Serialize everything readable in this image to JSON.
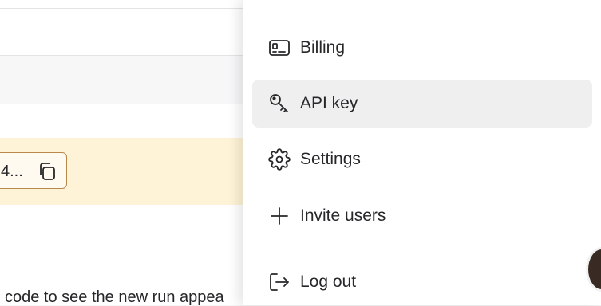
{
  "background": {
    "key_text": "4...",
    "help_text": "code to see the new run appea"
  },
  "menu": {
    "items": [
      {
        "label": "Billing",
        "icon": "billing-icon"
      },
      {
        "label": "API key",
        "icon": "key-icon",
        "active": true
      },
      {
        "label": "Settings",
        "icon": "gear-icon"
      },
      {
        "label": "Invite users",
        "icon": "plus-icon"
      },
      {
        "label": "Log out",
        "icon": "logout-icon"
      }
    ]
  },
  "colors": {
    "accent_highlight": "#efefef",
    "notice_background": "#fef3d6",
    "notice_border": "#b8894a",
    "text": "#27272a"
  }
}
